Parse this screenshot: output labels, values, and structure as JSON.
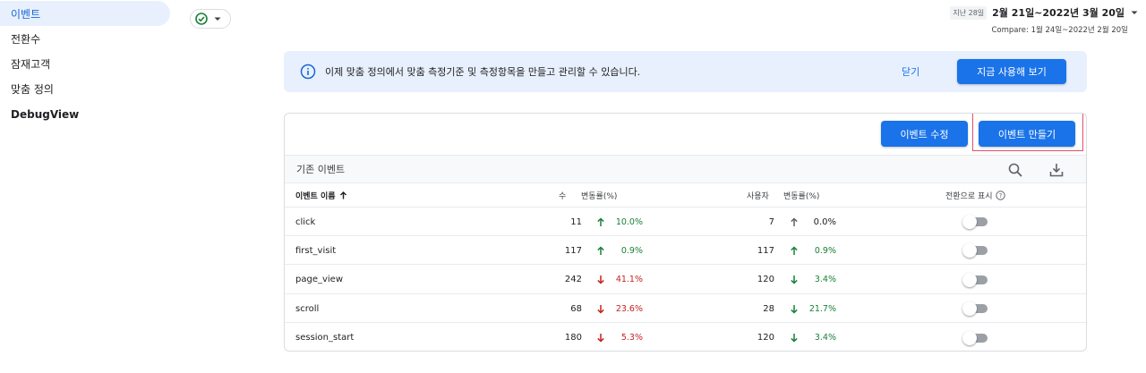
{
  "sidebar": {
    "items": [
      {
        "label": "이벤트",
        "active": true
      },
      {
        "label": "전환수"
      },
      {
        "label": "잠재고객"
      },
      {
        "label": "맞춤 정의"
      },
      {
        "label": "DebugView"
      }
    ]
  },
  "date": {
    "label": "지난 28일",
    "range": "2월 21일~2022년 3월 20일",
    "compare": "Compare: 1월 24일~2022년 2월 20일"
  },
  "banner": {
    "text": "이제 맞춤 정의에서 맞춤 측정기준 및 측정항목을 만들고 관리할 수 있습니다.",
    "close_label": "닫기",
    "cta_label": "지금 사용해 보기"
  },
  "card": {
    "edit_label": "이벤트 수정",
    "create_label": "이벤트 만들기",
    "toolbar_title": "기존 이벤트",
    "columns": {
      "name": "이벤트 이름",
      "count": "수",
      "count_change": "변동률(%)",
      "users": "사용자",
      "users_change": "변동률(%)",
      "conversion": "전환으로 표시"
    },
    "rows": [
      {
        "name": "click",
        "count": "11",
        "count_dir": "up",
        "count_pct": "10.0%",
        "users": "7",
        "users_dir": "flat",
        "users_pct": "0.0%"
      },
      {
        "name": "first_visit",
        "count": "117",
        "count_dir": "up",
        "count_pct": "0.9%",
        "users": "117",
        "users_dir": "up",
        "users_pct": "0.9%"
      },
      {
        "name": "page_view",
        "count": "242",
        "count_dir": "down",
        "count_pct": "41.1%",
        "users": "120",
        "users_dir": "down-green",
        "users_pct": "3.4%"
      },
      {
        "name": "scroll",
        "count": "68",
        "count_dir": "down",
        "count_pct": "23.6%",
        "users": "28",
        "users_dir": "down-green",
        "users_pct": "21.7%"
      },
      {
        "name": "session_start",
        "count": "180",
        "count_dir": "down",
        "count_pct": "5.3%",
        "users": "120",
        "users_dir": "down-green",
        "users_pct": "3.4%"
      }
    ]
  },
  "colors": {
    "accent": "#1a73e8",
    "up": "#188038",
    "down": "#c5221f",
    "neutral": "#5f6368"
  }
}
